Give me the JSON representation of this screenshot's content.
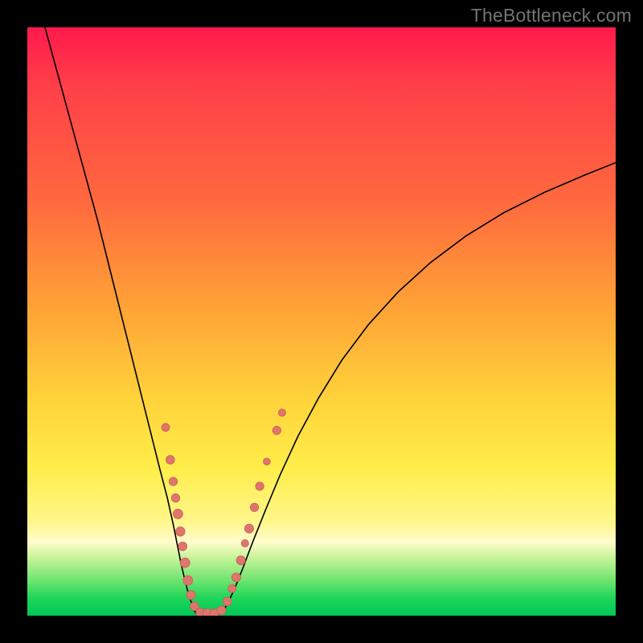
{
  "watermark": "TheBottleneck.com",
  "colors": {
    "dot_fill": "#df756d",
    "dot_stroke": "#c45b55",
    "curve": "#000000"
  },
  "chart_data": {
    "type": "line",
    "title": "",
    "xlabel": "",
    "ylabel": "",
    "xlim": [
      0,
      100
    ],
    "ylim": [
      0,
      100
    ],
    "series": [
      {
        "name": "left-branch",
        "x": [
          3,
          6,
          9,
          12,
          14,
          16,
          18,
          19.5,
          21,
          22.5,
          23.8,
          24.8,
          25.6,
          26.2,
          26.8,
          27.3,
          27.8,
          28.2,
          28.7
        ],
        "y": [
          100,
          89,
          78,
          67,
          59,
          51,
          43,
          37,
          31,
          25,
          20,
          15.5,
          11.5,
          8.5,
          6,
          4,
          2.5,
          1.3,
          0.3
        ]
      },
      {
        "name": "floor",
        "x": [
          28.7,
          30.0,
          31.5,
          33.0
        ],
        "y": [
          0.3,
          0.0,
          0.0,
          0.3
        ]
      },
      {
        "name": "right-branch",
        "x": [
          33.0,
          34.0,
          35.2,
          36.6,
          38.3,
          40.5,
          43.0,
          46.0,
          49.5,
          53.5,
          58.0,
          63.0,
          68.5,
          74.5,
          81.0,
          88.0,
          95.0,
          100.0
        ],
        "y": [
          0.3,
          2.0,
          4.5,
          8.0,
          12.5,
          18.0,
          24.0,
          30.5,
          37.0,
          43.5,
          49.5,
          55.0,
          60.0,
          64.5,
          68.5,
          72.0,
          75.0,
          77.0
        ]
      }
    ],
    "points": {
      "name": "highlighted-samples",
      "items": [
        {
          "x": 23.5,
          "y": 32.0,
          "r": 5.0
        },
        {
          "x": 24.3,
          "y": 26.5,
          "r": 5.4
        },
        {
          "x": 24.8,
          "y": 22.8,
          "r": 5.2
        },
        {
          "x": 25.2,
          "y": 20.0,
          "r": 5.2
        },
        {
          "x": 25.6,
          "y": 17.3,
          "r": 6.0
        },
        {
          "x": 26.0,
          "y": 14.3,
          "r": 5.8
        },
        {
          "x": 26.4,
          "y": 11.8,
          "r": 5.4
        },
        {
          "x": 26.8,
          "y": 9.0,
          "r": 6.0
        },
        {
          "x": 27.3,
          "y": 6.0,
          "r": 6.0
        },
        {
          "x": 27.8,
          "y": 3.5,
          "r": 5.6
        },
        {
          "x": 28.4,
          "y": 1.6,
          "r": 5.4
        },
        {
          "x": 29.4,
          "y": 0.5,
          "r": 5.6
        },
        {
          "x": 30.6,
          "y": 0.4,
          "r": 5.8
        },
        {
          "x": 31.8,
          "y": 0.4,
          "r": 5.6
        },
        {
          "x": 33.0,
          "y": 0.9,
          "r": 5.6
        },
        {
          "x": 34.0,
          "y": 2.4,
          "r": 5.4
        },
        {
          "x": 34.8,
          "y": 4.6,
          "r": 5.0
        },
        {
          "x": 35.5,
          "y": 6.5,
          "r": 5.6
        },
        {
          "x": 36.3,
          "y": 9.4,
          "r": 5.6
        },
        {
          "x": 37.0,
          "y": 12.3,
          "r": 4.6
        },
        {
          "x": 37.7,
          "y": 14.8,
          "r": 5.6
        },
        {
          "x": 38.6,
          "y": 18.4,
          "r": 5.2
        },
        {
          "x": 39.5,
          "y": 22.0,
          "r": 5.2
        },
        {
          "x": 40.7,
          "y": 26.2,
          "r": 4.4
        },
        {
          "x": 42.4,
          "y": 31.5,
          "r": 5.2
        },
        {
          "x": 43.3,
          "y": 34.5,
          "r": 4.6
        }
      ]
    }
  }
}
